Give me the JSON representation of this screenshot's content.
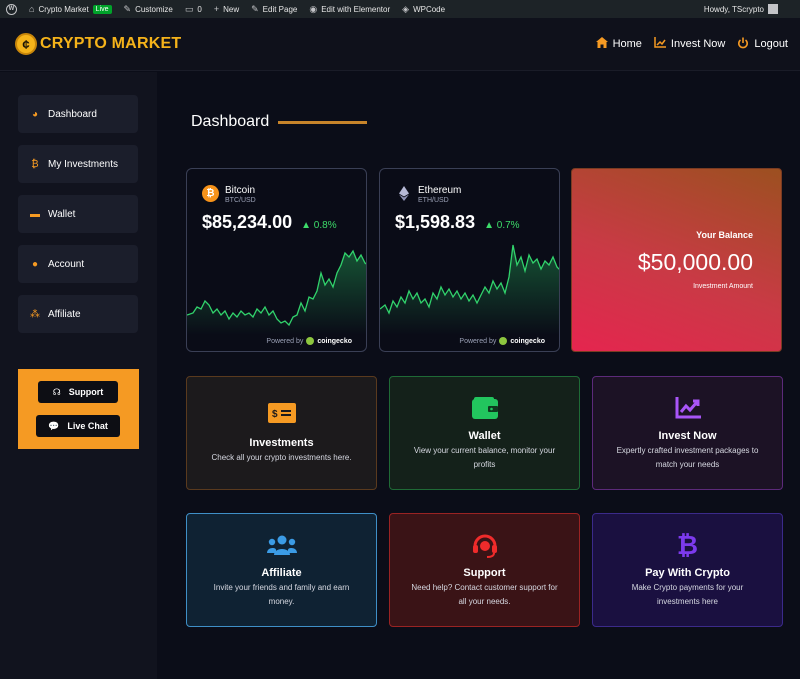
{
  "adminbar": {
    "site_name": "Crypto Market",
    "live_badge": "Live",
    "customize": "Customize",
    "comments_count": "0",
    "new": "New",
    "edit_page": "Edit Page",
    "edit_elementor": "Edit with Elementor",
    "wpcode": "WPCode",
    "howdy": "Howdy, TScrypto"
  },
  "header": {
    "logo_part1": "CRYPTO",
    "logo_part2": "MARKET",
    "nav": [
      {
        "label": "Home",
        "icon": "home-icon"
      },
      {
        "label": "Invest Now",
        "icon": "chart-line-icon"
      },
      {
        "label": "Logout",
        "icon": "power-icon"
      }
    ]
  },
  "sidebar": {
    "items": [
      {
        "label": "Dashboard",
        "icon": "pie-chart-icon"
      },
      {
        "label": "My Investments",
        "icon": "bitcoin-icon"
      },
      {
        "label": "Wallet",
        "icon": "wallet-icon"
      },
      {
        "label": "Account",
        "icon": "user-icon"
      },
      {
        "label": "Affiliate",
        "icon": "users-icon"
      }
    ],
    "support_label": "Support",
    "livechat_label": "Live Chat",
    "box_color": "#f59a23"
  },
  "main": {
    "title": "Dashboard",
    "coins": [
      {
        "name": "Bitcoin",
        "pair": "BTC/USD",
        "price": "$85,234.00",
        "change": "0.8%",
        "powered": "Powered by",
        "provider": "coingecko"
      },
      {
        "name": "Ethereum",
        "pair": "ETH/USD",
        "price": "$1,598.83",
        "change": "0.7%",
        "powered": "Powered by",
        "provider": "coingecko"
      }
    ],
    "balance": {
      "label": "Your Balance",
      "amount": "$50,000.00",
      "sub": "Investment Amount"
    },
    "tiles": [
      {
        "title": "Investments",
        "desc": "Check all your crypto investments here.",
        "icon": "money-icon",
        "color": "#f59a23"
      },
      {
        "title": "Wallet",
        "desc": "View your current balance, monitor your profits",
        "icon": "wallet-icon",
        "color": "#22c55e"
      },
      {
        "title": "Invest Now",
        "desc": "Expertly crafted investment packages to match your needs",
        "icon": "chart-line-icon",
        "color": "#a855f7"
      },
      {
        "title": "Affiliate",
        "desc": "Invite your friends and family and earn money.",
        "icon": "users-icon",
        "color": "#3b9be5"
      },
      {
        "title": "Support",
        "desc": "Need help? Contact customer support for all your needs.",
        "icon": "headset-icon",
        "color": "#ef2b2b"
      },
      {
        "title": "Pay With Crypto",
        "desc": "Make Crypto payments for your investments here",
        "icon": "bitcoin-icon",
        "color": "#7c3aed"
      }
    ]
  }
}
